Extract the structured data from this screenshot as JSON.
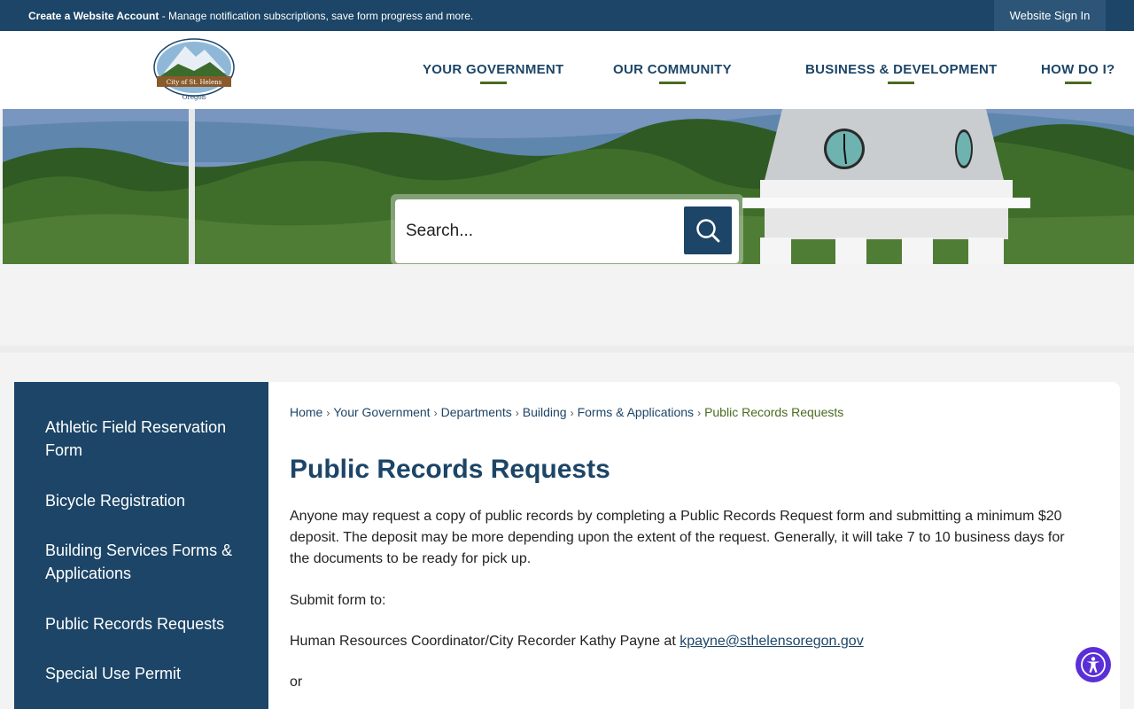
{
  "topbar": {
    "account_bold": "Create a Website Account",
    "account_rest": " - Manage notification subscriptions, save form progress and more.",
    "signin": "Website Sign In"
  },
  "nav": [
    {
      "label": "YOUR GOVERNMENT"
    },
    {
      "label": "OUR COMMUNITY"
    },
    {
      "label": "BUSINESS & DEVELOPMENT"
    },
    {
      "label": "HOW DO I?"
    }
  ],
  "logo": {
    "line1": "City of St. Helens",
    "line2": "Oregon"
  },
  "search": {
    "placeholder": "Search..."
  },
  "sidebar": {
    "items": [
      {
        "label": "Athletic Field Reservation Form"
      },
      {
        "label": "Bicycle Registration"
      },
      {
        "label": "Building Services Forms & Applications"
      },
      {
        "label": "Public Records Requests"
      },
      {
        "label": "Special Use Permit"
      }
    ]
  },
  "breadcrumb": {
    "items": [
      "Home",
      "Your Government",
      "Departments",
      "Building",
      "Forms & Applications"
    ],
    "current": "Public Records Requests"
  },
  "page": {
    "title": "Public Records Requests",
    "p1": "Anyone may request a copy of public records by completing a Public Records Request form and submitting a minimum $20 deposit. The deposit may be more depending upon the extent of the request. Generally, it will take 7 to 10 business days for the documents to be ready for pick up.",
    "p2": "Submit form to:",
    "p3_text": "Human Resources Coordinator/City Recorder Kathy Payne at ",
    "p3_link": "kpayne@sthelensoregon.gov",
    "p4": "or"
  },
  "colors": {
    "primary": "#1c4567",
    "accent": "#4a6b1f",
    "a11y": "#5b2fd8"
  }
}
